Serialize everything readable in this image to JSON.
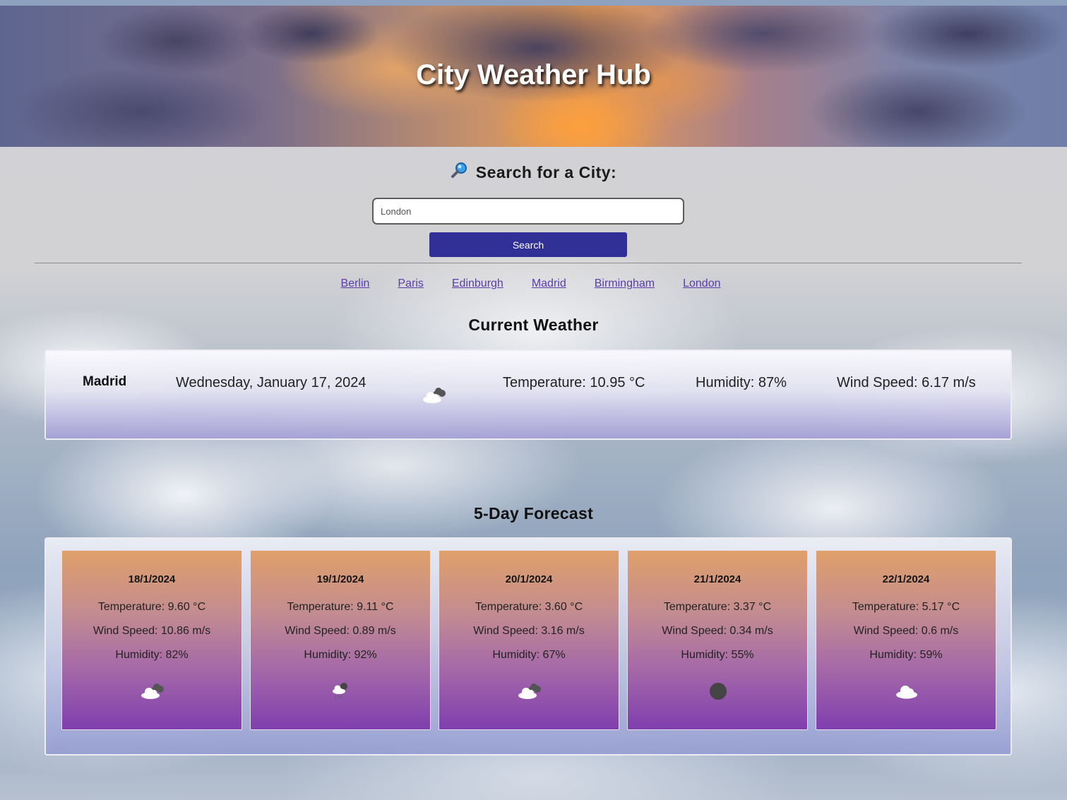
{
  "header": {
    "title": "City Weather Hub"
  },
  "search": {
    "heading": "Search for a City:",
    "icon": "magnifying-glass-icon",
    "placeholder": "London",
    "button_label": "Search"
  },
  "recent_cities": [
    "Berlin",
    "Paris",
    "Edinburgh",
    "Madrid",
    "Birmingham",
    "London"
  ],
  "current": {
    "section_title": "Current Weather",
    "city": "Madrid",
    "date": "Wednesday, January 17, 2024",
    "icon": "broken-clouds-icon",
    "temperature": "Temperature: 10.95 °C",
    "humidity": "Humidity: 87%",
    "wind": "Wind Speed: 6.17 m/s"
  },
  "forecast": {
    "section_title": "5-Day Forecast",
    "days": [
      {
        "date": "18/1/2024",
        "temperature": "Temperature: 9.60 °C",
        "wind": "Wind Speed: 10.86 m/s",
        "humidity": "Humidity: 82%",
        "icon": "broken-clouds-icon"
      },
      {
        "date": "19/1/2024",
        "temperature": "Temperature: 9.11 °C",
        "wind": "Wind Speed: 0.89 m/s",
        "humidity": "Humidity: 92%",
        "icon": "light-rain-icon"
      },
      {
        "date": "20/1/2024",
        "temperature": "Temperature: 3.60 °C",
        "wind": "Wind Speed: 3.16 m/s",
        "humidity": "Humidity: 67%",
        "icon": "broken-clouds-icon"
      },
      {
        "date": "21/1/2024",
        "temperature": "Temperature: 3.37 °C",
        "wind": "Wind Speed: 0.34 m/s",
        "humidity": "Humidity: 55%",
        "icon": "clear-night-icon"
      },
      {
        "date": "22/1/2024",
        "temperature": "Temperature: 5.17 °C",
        "wind": "Wind Speed: 0.6 m/s",
        "humidity": "Humidity: 59%",
        "icon": "few-clouds-icon"
      }
    ]
  },
  "colors": {
    "button": "#303096",
    "link": "#5a3da8",
    "card_top": "#e0a06a",
    "card_bottom": "#7f3fae"
  }
}
